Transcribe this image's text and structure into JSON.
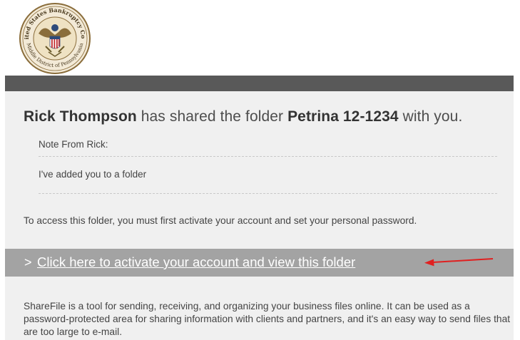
{
  "header": {
    "seal_text_top": "United States Bankruptcy Court",
    "seal_text_bottom": "Middle District of Pennsylvania"
  },
  "share": {
    "sender_name": "Rick Thompson",
    "mid_text": " has shared the folder ",
    "folder_name": "Petrina 12-1234",
    "end_text": " with you."
  },
  "note": {
    "label": "Note From Rick:",
    "text": "I've added you to a folder"
  },
  "access_text": "To access this folder, you must first activate your account and set your personal password.",
  "cta": {
    "chevron": ">",
    "link_label": "Click here to activate your account and view this folder"
  },
  "about_text": "ShareFile is a tool for sending, receiving, and organizing your business files online. It can be used as a password-protected area for sharing information with clients and partners, and it's an easy way to send files that are too large to e-mail.",
  "colors": {
    "dark_bar": "#595959",
    "content_bg": "#f0f0f0",
    "cta_bar": "#a3a3a3",
    "annotation_arrow": "#e02020"
  }
}
